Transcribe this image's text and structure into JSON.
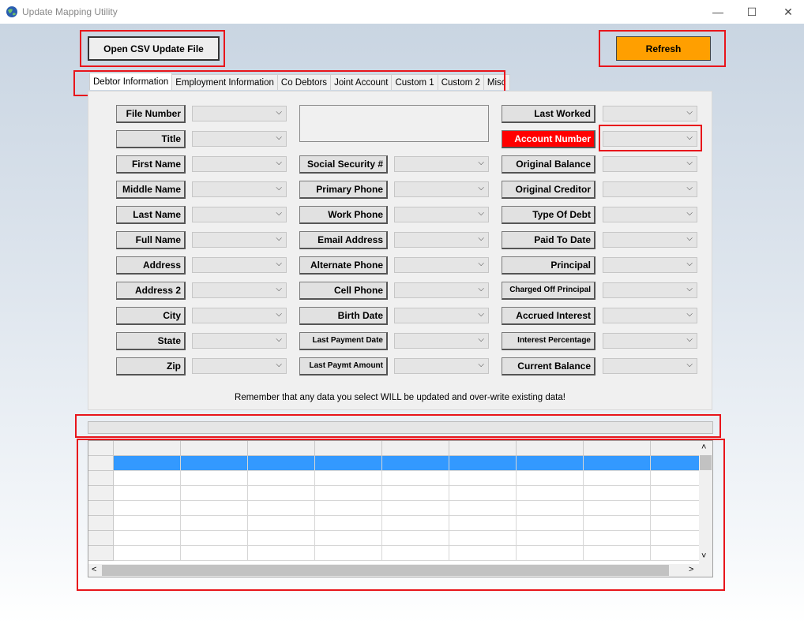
{
  "window": {
    "title": "Update Mapping Utility",
    "minimize": "—",
    "maximize": "☐",
    "close": "✕"
  },
  "toolbar": {
    "open_label": "Open CSV Update File",
    "refresh_label": "Refresh",
    "refresh_color": "#ff9f00"
  },
  "tabs": [
    "Debtor Information",
    "Employment Information",
    "Co Debtors",
    "Joint Account",
    "Custom 1",
    "Custom 2",
    "Misc"
  ],
  "fields": {
    "col1": [
      "File Number",
      "Title",
      "First Name",
      "Middle Name",
      "Last Name",
      "Full Name",
      "Address",
      "Address 2",
      "City",
      "State",
      "Zip"
    ],
    "col2": [
      "Social Security #",
      "Primary Phone",
      "Work  Phone",
      "Email Address",
      "Alternate Phone",
      "Cell Phone",
      "Birth Date",
      "Last Payment Date",
      "Last Paymt Amount"
    ],
    "col3": [
      "Last Worked",
      "Account Number",
      "Original Balance",
      "Original Creditor",
      "Type Of Debt",
      "Paid To Date",
      "Principal",
      "Charged Off Principal",
      "Accrued Interest",
      "Interest Percentage",
      "Current Balance"
    ]
  },
  "highlight": {
    "required_field": "Account Number",
    "color": "#ff0000"
  },
  "note": "Remember that any data you select WILL be updated and over-write existing data!",
  "grid": {
    "selection_color": "#3399ff",
    "scroll_up": "˄",
    "scroll_down": "˅",
    "scroll_left": "<",
    "scroll_right": ">"
  }
}
